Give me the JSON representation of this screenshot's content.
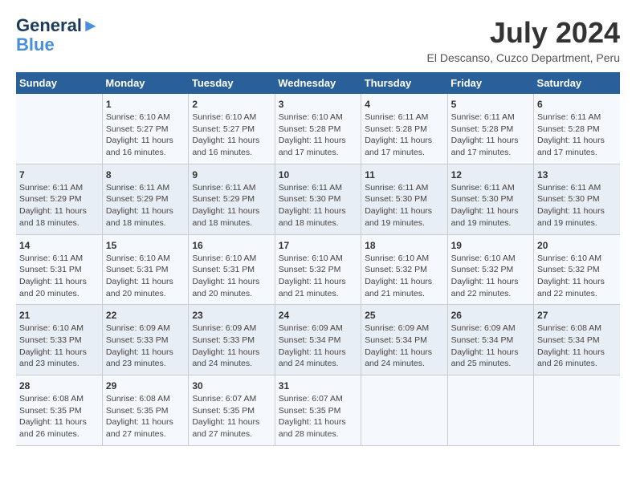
{
  "header": {
    "logo_line1": "General",
    "logo_line2": "Blue",
    "month_year": "July 2024",
    "location": "El Descanso, Cuzco Department, Peru"
  },
  "days_of_week": [
    "Sunday",
    "Monday",
    "Tuesday",
    "Wednesday",
    "Thursday",
    "Friday",
    "Saturday"
  ],
  "weeks": [
    [
      {
        "day": "",
        "sunrise": "",
        "sunset": "",
        "daylight": ""
      },
      {
        "day": "1",
        "sunrise": "6:10 AM",
        "sunset": "5:27 PM",
        "daylight": "11 hours and 16 minutes."
      },
      {
        "day": "2",
        "sunrise": "6:10 AM",
        "sunset": "5:27 PM",
        "daylight": "11 hours and 16 minutes."
      },
      {
        "day": "3",
        "sunrise": "6:10 AM",
        "sunset": "5:28 PM",
        "daylight": "11 hours and 17 minutes."
      },
      {
        "day": "4",
        "sunrise": "6:11 AM",
        "sunset": "5:28 PM",
        "daylight": "11 hours and 17 minutes."
      },
      {
        "day": "5",
        "sunrise": "6:11 AM",
        "sunset": "5:28 PM",
        "daylight": "11 hours and 17 minutes."
      },
      {
        "day": "6",
        "sunrise": "6:11 AM",
        "sunset": "5:28 PM",
        "daylight": "11 hours and 17 minutes."
      }
    ],
    [
      {
        "day": "7",
        "sunrise": "6:11 AM",
        "sunset": "5:29 PM",
        "daylight": "11 hours and 18 minutes."
      },
      {
        "day": "8",
        "sunrise": "6:11 AM",
        "sunset": "5:29 PM",
        "daylight": "11 hours and 18 minutes."
      },
      {
        "day": "9",
        "sunrise": "6:11 AM",
        "sunset": "5:29 PM",
        "daylight": "11 hours and 18 minutes."
      },
      {
        "day": "10",
        "sunrise": "6:11 AM",
        "sunset": "5:30 PM",
        "daylight": "11 hours and 18 minutes."
      },
      {
        "day": "11",
        "sunrise": "6:11 AM",
        "sunset": "5:30 PM",
        "daylight": "11 hours and 19 minutes."
      },
      {
        "day": "12",
        "sunrise": "6:11 AM",
        "sunset": "5:30 PM",
        "daylight": "11 hours and 19 minutes."
      },
      {
        "day": "13",
        "sunrise": "6:11 AM",
        "sunset": "5:30 PM",
        "daylight": "11 hours and 19 minutes."
      }
    ],
    [
      {
        "day": "14",
        "sunrise": "6:11 AM",
        "sunset": "5:31 PM",
        "daylight": "11 hours and 20 minutes."
      },
      {
        "day": "15",
        "sunrise": "6:10 AM",
        "sunset": "5:31 PM",
        "daylight": "11 hours and 20 minutes."
      },
      {
        "day": "16",
        "sunrise": "6:10 AM",
        "sunset": "5:31 PM",
        "daylight": "11 hours and 20 minutes."
      },
      {
        "day": "17",
        "sunrise": "6:10 AM",
        "sunset": "5:32 PM",
        "daylight": "11 hours and 21 minutes."
      },
      {
        "day": "18",
        "sunrise": "6:10 AM",
        "sunset": "5:32 PM",
        "daylight": "11 hours and 21 minutes."
      },
      {
        "day": "19",
        "sunrise": "6:10 AM",
        "sunset": "5:32 PM",
        "daylight": "11 hours and 22 minutes."
      },
      {
        "day": "20",
        "sunrise": "6:10 AM",
        "sunset": "5:32 PM",
        "daylight": "11 hours and 22 minutes."
      }
    ],
    [
      {
        "day": "21",
        "sunrise": "6:10 AM",
        "sunset": "5:33 PM",
        "daylight": "11 hours and 23 minutes."
      },
      {
        "day": "22",
        "sunrise": "6:09 AM",
        "sunset": "5:33 PM",
        "daylight": "11 hours and 23 minutes."
      },
      {
        "day": "23",
        "sunrise": "6:09 AM",
        "sunset": "5:33 PM",
        "daylight": "11 hours and 24 minutes."
      },
      {
        "day": "24",
        "sunrise": "6:09 AM",
        "sunset": "5:34 PM",
        "daylight": "11 hours and 24 minutes."
      },
      {
        "day": "25",
        "sunrise": "6:09 AM",
        "sunset": "5:34 PM",
        "daylight": "11 hours and 24 minutes."
      },
      {
        "day": "26",
        "sunrise": "6:09 AM",
        "sunset": "5:34 PM",
        "daylight": "11 hours and 25 minutes."
      },
      {
        "day": "27",
        "sunrise": "6:08 AM",
        "sunset": "5:34 PM",
        "daylight": "11 hours and 26 minutes."
      }
    ],
    [
      {
        "day": "28",
        "sunrise": "6:08 AM",
        "sunset": "5:35 PM",
        "daylight": "11 hours and 26 minutes."
      },
      {
        "day": "29",
        "sunrise": "6:08 AM",
        "sunset": "5:35 PM",
        "daylight": "11 hours and 27 minutes."
      },
      {
        "day": "30",
        "sunrise": "6:07 AM",
        "sunset": "5:35 PM",
        "daylight": "11 hours and 27 minutes."
      },
      {
        "day": "31",
        "sunrise": "6:07 AM",
        "sunset": "5:35 PM",
        "daylight": "11 hours and 28 minutes."
      },
      {
        "day": "",
        "sunrise": "",
        "sunset": "",
        "daylight": ""
      },
      {
        "day": "",
        "sunrise": "",
        "sunset": "",
        "daylight": ""
      },
      {
        "day": "",
        "sunrise": "",
        "sunset": "",
        "daylight": ""
      }
    ]
  ]
}
